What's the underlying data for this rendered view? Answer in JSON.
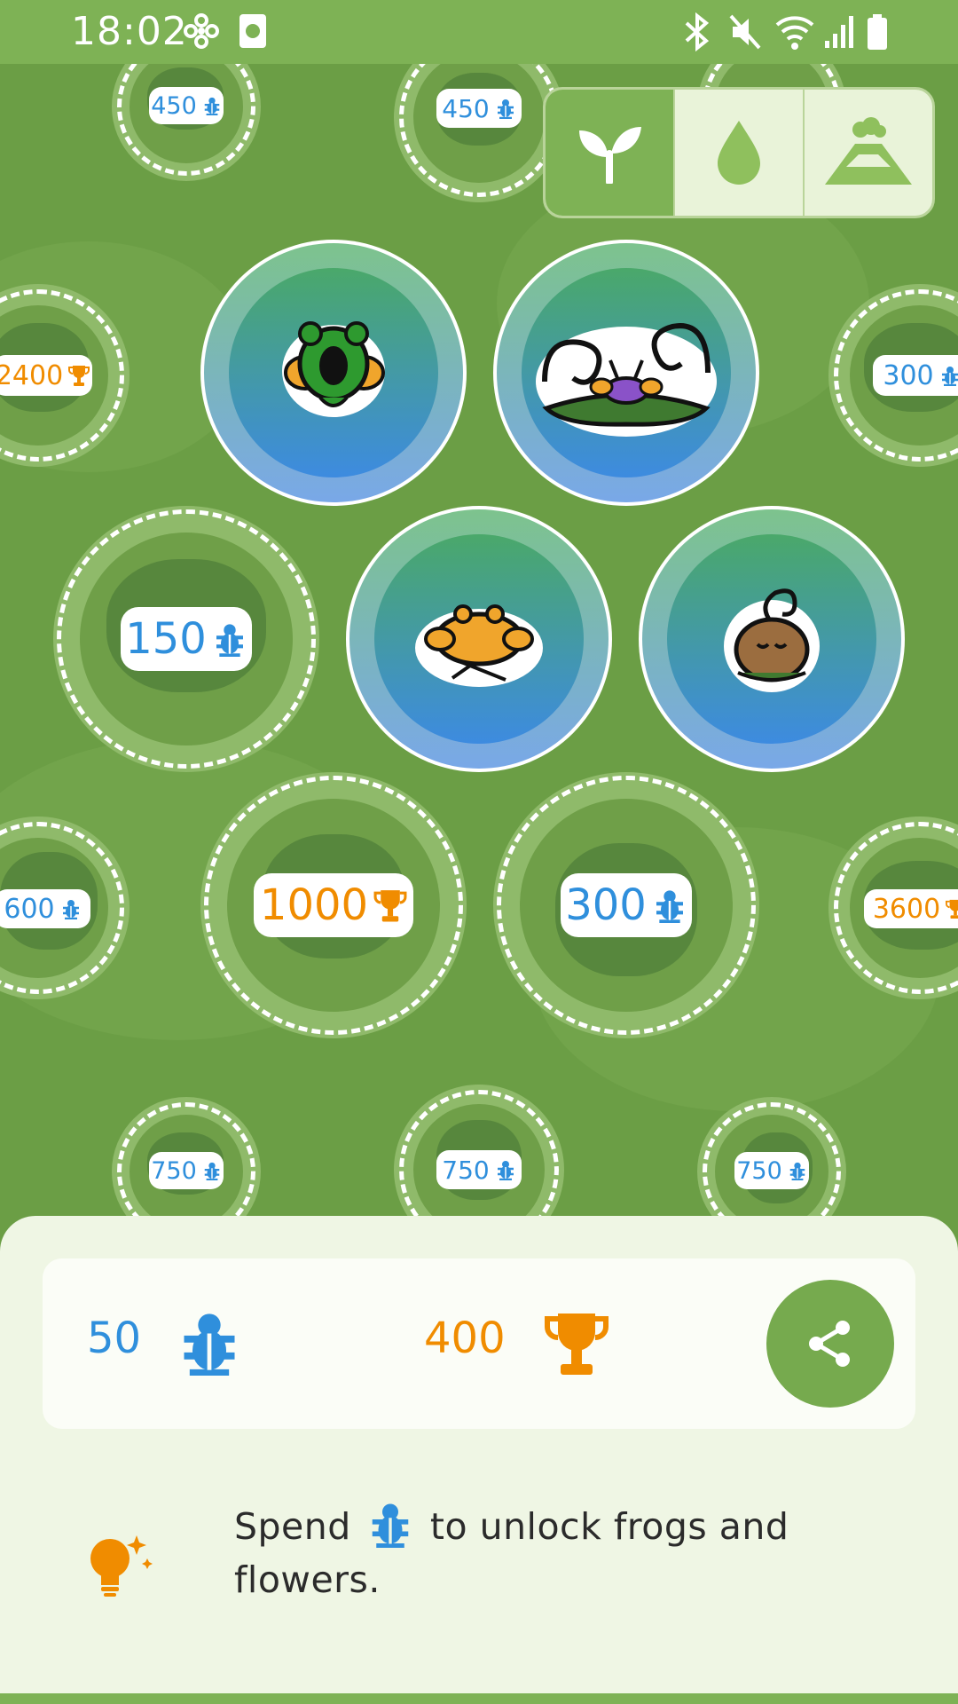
{
  "status_bar": {
    "time": "18:02",
    "left_icons": [
      "fan-icon",
      "app-icon"
    ],
    "right_icons": [
      "bluetooth-icon",
      "mute-icon",
      "wifi-icon",
      "signal-icon",
      "battery-icon"
    ]
  },
  "tabs": [
    {
      "name": "sprout-icon",
      "active": true
    },
    {
      "name": "water-drop-icon",
      "active": false
    },
    {
      "name": "volcano-icon",
      "active": false
    }
  ],
  "nodes": [
    {
      "id": "n1",
      "state": "locked",
      "cost": "450",
      "currency": "bug"
    },
    {
      "id": "n2",
      "state": "locked",
      "cost": "450",
      "currency": "bug"
    },
    {
      "id": "n3",
      "state": "locked",
      "cost": "2400",
      "currency": "trophy"
    },
    {
      "id": "n4",
      "state": "unlocked",
      "frog": "green-frog"
    },
    {
      "id": "n5",
      "state": "unlocked",
      "frog": "purple-swirl-frog"
    },
    {
      "id": "n6",
      "state": "locked",
      "cost": "300",
      "currency": "bug"
    },
    {
      "id": "n7",
      "state": "locked",
      "cost": "150",
      "currency": "bug"
    },
    {
      "id": "n8",
      "state": "unlocked",
      "frog": "orange-frog"
    },
    {
      "id": "n9",
      "state": "unlocked",
      "frog": "brown-frog"
    },
    {
      "id": "n10",
      "state": "locked",
      "cost": "600",
      "currency": "bug"
    },
    {
      "id": "n11",
      "state": "locked",
      "cost": "1000",
      "currency": "trophy"
    },
    {
      "id": "n12",
      "state": "locked",
      "cost": "300",
      "currency": "bug"
    },
    {
      "id": "n13",
      "state": "locked",
      "cost": "3600",
      "currency": "trophy"
    },
    {
      "id": "n14",
      "state": "locked",
      "cost": "750",
      "currency": "bug"
    },
    {
      "id": "n15",
      "state": "locked",
      "cost": "750",
      "currency": "bug"
    },
    {
      "id": "n16",
      "state": "locked",
      "cost": "750",
      "currency": "bug"
    }
  ],
  "stats": {
    "bugs": "50",
    "trophies": "400"
  },
  "tip": {
    "before": "Spend",
    "after": "to unlock frogs and flowers."
  },
  "colors": {
    "bug": "#2f8fdc",
    "trophy": "#f08c00",
    "brand_green": "#7eb255",
    "map_green": "#6b9e45"
  }
}
